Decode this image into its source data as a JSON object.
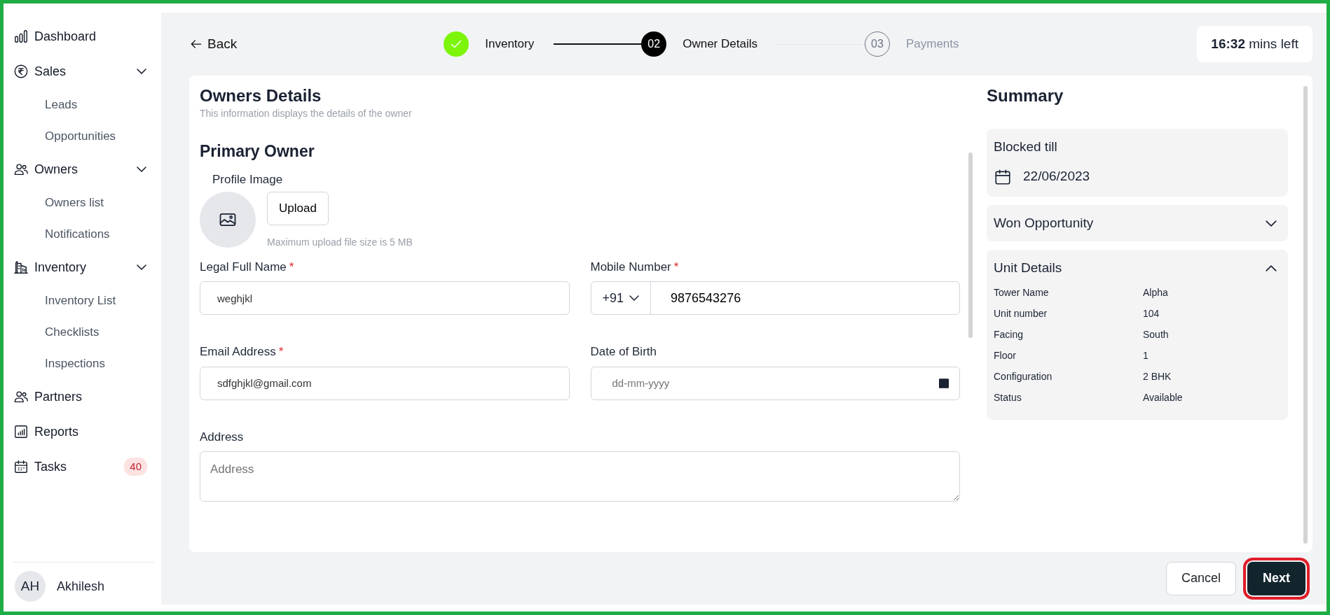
{
  "sidebar": {
    "items": [
      {
        "label": "Dashboard"
      },
      {
        "label": "Sales",
        "expanded": true,
        "children": [
          {
            "label": "Leads"
          },
          {
            "label": "Opportunities"
          }
        ]
      },
      {
        "label": "Owners",
        "expanded": true,
        "children": [
          {
            "label": "Owners list"
          },
          {
            "label": "Notifications"
          }
        ]
      },
      {
        "label": "Inventory",
        "expanded": true,
        "children": [
          {
            "label": "Inventory List"
          },
          {
            "label": "Checklists"
          },
          {
            "label": "Inspections"
          }
        ]
      },
      {
        "label": "Partners"
      },
      {
        "label": "Reports"
      },
      {
        "label": "Tasks",
        "badge": "40"
      }
    ],
    "user": {
      "initials": "AH",
      "name": "Akhilesh"
    }
  },
  "header": {
    "back": "Back",
    "steps": [
      {
        "label": "Inventory",
        "done": true,
        "selected": false
      },
      {
        "number": "02",
        "label": "Owner Details",
        "done": false,
        "selected": true
      },
      {
        "number": "03",
        "label": "Payments",
        "done": false,
        "selected": false
      }
    ],
    "timer": {
      "time": "16:32",
      "suffix": "mins left"
    }
  },
  "form": {
    "title": "Owners Details",
    "subtitle": "This information displays the details of the owner",
    "section": "Primary Owner",
    "profile_image": {
      "label": "Profile Image",
      "button": "Upload",
      "hint": "Maximum upload file size is 5 MB"
    },
    "fields": [
      {
        "kind": "text",
        "label": "Legal Full Name",
        "required_mark": "*",
        "value": "weghjkl"
      },
      {
        "kind": "phone",
        "label": "Mobile Number",
        "required_mark": "*",
        "code": "+91",
        "value": "9876543276"
      },
      {
        "kind": "text",
        "label": "Email Address",
        "required_mark": "*",
        "value": "sdfghjkl@gmail.com"
      },
      {
        "kind": "date",
        "label": "Date of Birth",
        "placeholder": "dd-mm-yyyy"
      },
      {
        "kind": "textarea",
        "label": "Address",
        "placeholder": "Address"
      }
    ]
  },
  "summary": {
    "title": "Summary",
    "blocked": {
      "label": "Blocked till",
      "date": "22/06/2023"
    },
    "sections": [
      {
        "title": "Won Opportunity",
        "expanded": false
      },
      {
        "title": "Unit Details",
        "expanded": true,
        "rows": [
          {
            "label": "Tower Name",
            "value": "Alpha"
          },
          {
            "label": "Unit number",
            "value": "104"
          },
          {
            "label": "Facing",
            "value": "South"
          },
          {
            "label": "Floor",
            "value": "1"
          },
          {
            "label": "Configuration",
            "value": "2 BHK"
          },
          {
            "label": "Status",
            "value": "Available"
          }
        ]
      }
    ]
  },
  "footer": {
    "buttons": [
      {
        "label": "Cancel",
        "kind": "secondary",
        "highlighted": false
      },
      {
        "label": "Next",
        "kind": "primary",
        "highlighted": true
      }
    ]
  }
}
